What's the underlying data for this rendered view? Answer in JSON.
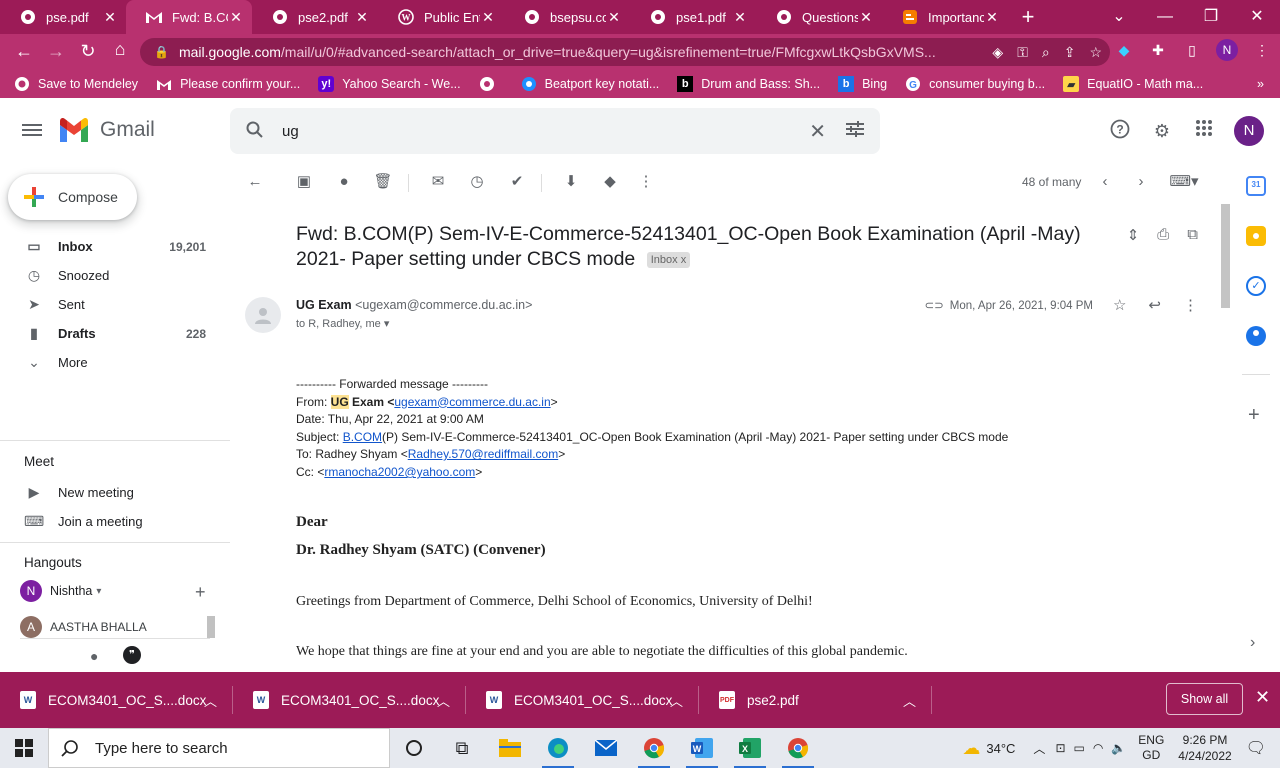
{
  "browser": {
    "tabs": [
      {
        "title": "pse.pdf",
        "icon": "chrome-icon"
      },
      {
        "title": "Fwd: B.COM",
        "icon": "gmail-icon",
        "active": true
      },
      {
        "title": "pse2.pdf",
        "icon": "chrome-icon"
      },
      {
        "title": "Public Enter",
        "icon": "wordpress-icon"
      },
      {
        "title": "bsepsu.com",
        "icon": "chrome-icon"
      },
      {
        "title": "pse1.pdf",
        "icon": "chrome-icon"
      },
      {
        "title": "Questions_I",
        "icon": "chrome-icon"
      },
      {
        "title": "Importance",
        "icon": "blogger-icon"
      }
    ],
    "url_host": "mail.google.com",
    "url_path": "/mail/u/0/#advanced-search/attach_or_drive=true&query=ug&isrefinement=true/FMfcgxwLtkQsbGxVMS...",
    "profile_initial": "N",
    "bookmarks": [
      "Save to Mendeley",
      "Please confirm your...",
      "Yahoo Search - We...",
      "",
      "Beatport key notati...",
      "Drum and Bass: Sh...",
      "Bing",
      "consumer buying b...",
      "EquatIO - Math ma..."
    ]
  },
  "gmail": {
    "app_name": "Gmail",
    "search_value": "ug",
    "profile_initial": "N",
    "compose_label": "Compose",
    "nav": [
      {
        "label": "Inbox",
        "count": "19,201",
        "bold": true
      },
      {
        "label": "Snoozed",
        "count": ""
      },
      {
        "label": "Sent",
        "count": ""
      },
      {
        "label": "Drafts",
        "count": "228",
        "bold": true
      },
      {
        "label": "More",
        "count": ""
      }
    ],
    "meet": {
      "title": "Meet",
      "new_meeting": "New meeting",
      "join_meeting": "Join a meeting"
    },
    "hangouts": {
      "title": "Hangouts",
      "user": "Nishtha",
      "user_initial": "N",
      "contact": "AASTHA BHALLA",
      "contact_initial": "A"
    },
    "counter": "48 of many",
    "message": {
      "subject_line1": "Fwd: B.COM(P) Sem-IV-E-Commerce-52413401_OC-Open Book Examination (April -May)",
      "subject_line2": "2021- Paper setting under CBCS mode",
      "label_chip": "Inbox",
      "sender_name": "UG Exam",
      "sender_email": "<ugexam@commerce.du.ac.in>",
      "to": "to R, Radhey, me",
      "date": "Mon, Apr 26, 2021, 9:04 PM",
      "forwarded_header": "---------- Forwarded message ---------",
      "from_label": "From: ",
      "from_name_hl": "UG",
      "from_name_rest": " Exam <",
      "from_email": "ugexam@commerce.du.ac.in",
      "date_line": "Date: Thu, Apr 22, 2021 at 9:00 AM",
      "subject_label": "Subject: ",
      "subject_link": "B.COM",
      "subject_rest": "(P) Sem-IV-E-Commerce-52413401_OC-Open Book Examination (April -May) 2021- Paper setting under CBCS mode",
      "to_label": "To: Radhey Shyam <",
      "to_email": "Radhey.570@rediffmail.com",
      "cc_label": "Cc: <",
      "cc_email": "rmanocha2002@yahoo.com",
      "dear": "Dear",
      "addressee": "Dr. Radhey Shyam (SATC) (Convener)",
      "greeting": "Greetings from Department of Commerce, Delhi School of Economics, University of Delhi!",
      "hope": "We hope that things are fine at your end and you are able to negotiate the difficulties of this global pandemic."
    }
  },
  "downloads": {
    "items": [
      {
        "name": "ECOM3401_OC_S....docx",
        "type": "word"
      },
      {
        "name": "ECOM3401_OC_S....docx",
        "type": "word"
      },
      {
        "name": "ECOM3401_OC_S....docx",
        "type": "word"
      },
      {
        "name": "pse2.pdf",
        "type": "pdf"
      }
    ],
    "show_all": "Show all"
  },
  "taskbar": {
    "search_placeholder": "Type here to search",
    "temperature": "34°C",
    "lang1": "ENG",
    "lang2": "GD",
    "time": "9:26 PM",
    "date": "4/24/2022"
  },
  "colors": {
    "chrome_bg": "#9c1b57",
    "chrome_toolbar": "#b8316f",
    "gmail_red": "#ea4335",
    "link": "#1155cc"
  }
}
